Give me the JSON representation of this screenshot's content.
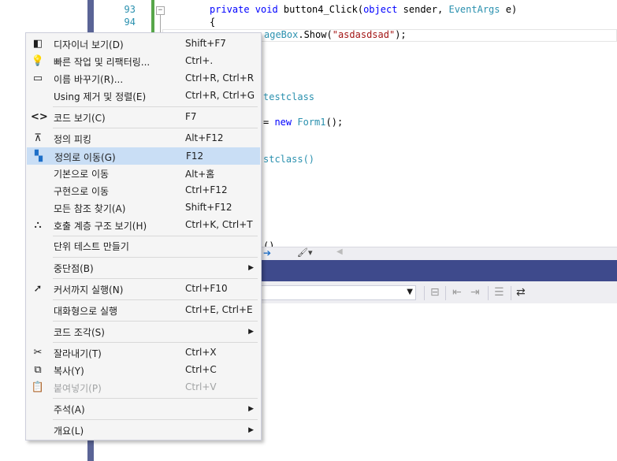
{
  "editor": {
    "line_numbers": [
      "93",
      "94"
    ],
    "code_lines": {
      "line93": {
        "keyword": "private void",
        "name": " button4_Click(",
        "kw2": "object",
        "rest1": " sender, ",
        "type": "EventArgs",
        "rest2": " e)"
      },
      "line94": "{",
      "messagebox_line": {
        "type": "ageBox",
        "mid": ".Show(",
        "str": "\"asdasdsad\"",
        "end": ");"
      },
      "frag_testclass1": "testclass",
      "frag_new": {
        "pre": "= ",
        "kw": "new",
        "type": " Form1",
        "end": "();"
      },
      "frag_testclass2": "stclass()",
      "frag_paren": "()"
    }
  },
  "context_menu": {
    "items": [
      {
        "label": "디자이너 보기(D)",
        "shortcut": "Shift+F7",
        "icon": "designer-icon"
      },
      {
        "label": "빠른 작업 및 리팩터링...",
        "shortcut": "Ctrl+.",
        "icon": "lightbulb-icon"
      },
      {
        "label": "이름 바꾸기(R)...",
        "shortcut": "Ctrl+R, Ctrl+R",
        "icon": "rename-icon"
      },
      {
        "label": "Using 제거 및 정렬(E)",
        "shortcut": "Ctrl+R, Ctrl+G"
      },
      {
        "label": "코드 보기(C)",
        "shortcut": "F7",
        "icon": "code-icon"
      },
      {
        "label": "정의 피킹",
        "shortcut": "Alt+F12",
        "icon": "peek-icon"
      },
      {
        "label": "정의로 이동(G)",
        "shortcut": "F12",
        "icon": "goto-definition-icon"
      },
      {
        "label": "기본으로 이동",
        "shortcut": "Alt+홈"
      },
      {
        "label": "구현으로 이동",
        "shortcut": "Ctrl+F12"
      },
      {
        "label": "모든 참조 찾기(A)",
        "shortcut": "Shift+F12"
      },
      {
        "label": "호출 계층 구조 보기(H)",
        "shortcut": "Ctrl+K, Ctrl+T",
        "icon": "call-hierarchy-icon"
      },
      {
        "label": "단위 테스트 만들기",
        "shortcut": ""
      },
      {
        "label": "중단점(B)",
        "shortcut": ""
      },
      {
        "label": "커서까지 실행(N)",
        "shortcut": "Ctrl+F10",
        "icon": "run-to-cursor-icon"
      },
      {
        "label": "대화형으로 실행",
        "shortcut": "Ctrl+E, Ctrl+E"
      },
      {
        "label": "코드 조각(S)",
        "shortcut": ""
      },
      {
        "label": "잘라내기(T)",
        "shortcut": "Ctrl+X",
        "icon": "scissors-icon"
      },
      {
        "label": "복사(Y)",
        "shortcut": "Ctrl+C",
        "icon": "copy-icon"
      },
      {
        "label": "붙여넣기(P)",
        "shortcut": "Ctrl+V",
        "icon": "paste-icon"
      },
      {
        "label": "주석(A)",
        "shortcut": ""
      },
      {
        "label": "개요(L)",
        "shortcut": ""
      }
    ],
    "highlighted_item": "정의로 이동(G)",
    "disabled_item": "붙여넣기(P)"
  },
  "colors": {
    "accent_title_bar": "#3e4a8c",
    "highlight": "#c9def5",
    "side_strip": "#5a6496"
  }
}
